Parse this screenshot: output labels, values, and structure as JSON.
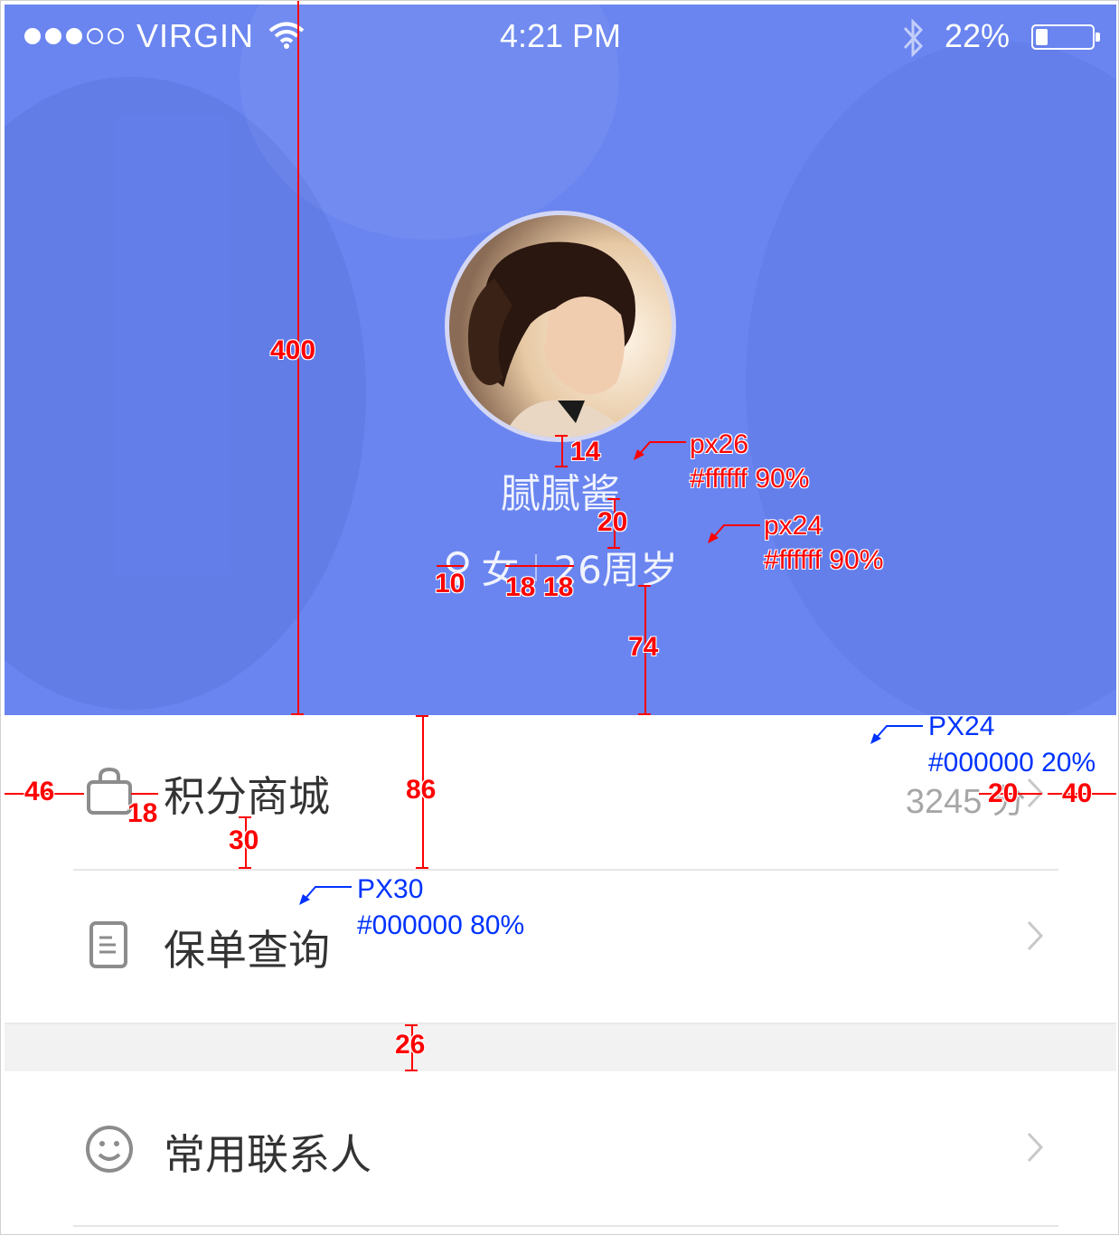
{
  "status_bar": {
    "carrier": "VIRGIN",
    "signal_filled": 3,
    "signal_total": 5,
    "time": "4:21 PM",
    "battery_percent": "22%",
    "battery_level": 0.22
  },
  "profile": {
    "username": "腻腻酱",
    "gender_icon": "♀",
    "gender": "女",
    "age": "26周岁",
    "header_color": "#6a85f0"
  },
  "menu": {
    "items": [
      {
        "label": "积分商城",
        "icon": "shopping-bag-icon",
        "value": "3245 分"
      },
      {
        "label": "保单查询",
        "icon": "document-icon",
        "value": ""
      },
      {
        "label": "常用联系人",
        "icon": "smiley-icon",
        "value": ""
      }
    ]
  },
  "annotations": {
    "header_height": "400",
    "avatar_gap": "14",
    "name_spec_size": "px26",
    "name_spec_color": "#ffffff 90%",
    "name_meta_gap": "20",
    "meta_spec_size": "px24",
    "meta_spec_color": "#ffffff 90%",
    "icon_gap": "10",
    "sep_gap_left": "18",
    "sep_gap_right": "18",
    "meta_bottom_gap": "74",
    "value_spec_size": "PX24",
    "value_spec_color": "#000000 20%",
    "left_margin": "46",
    "icon_text_gap": "18",
    "row_height": "86",
    "value_chevron_gap": "20",
    "right_margin": "40",
    "icon_size": "30",
    "label_spec_size": "PX30",
    "label_spec_color": "#000000 80%",
    "section_gap": "26"
  }
}
